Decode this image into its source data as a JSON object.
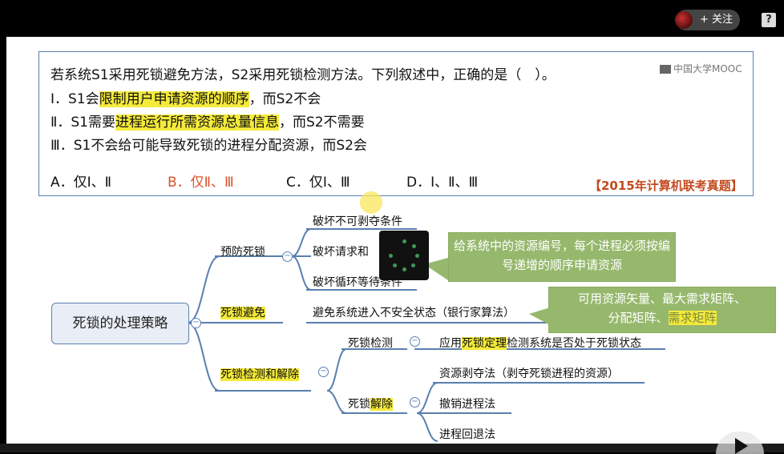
{
  "topbar": {
    "follow_label": "+ 关注",
    "help": "?"
  },
  "question": {
    "stem": "若系统S1采用死锁避免方法，S2采用死锁检测方法。下列叙述中，正确的是（　）。",
    "line1_pre": "Ⅰ．S1会",
    "line1_hl": "限制用户申请资源的顺序",
    "line1_post": "，而S2不会",
    "line2_pre": "Ⅱ．S1需要",
    "line2_hl": "进程运行所需资源总量信息",
    "line2_post": "，而S2不需要",
    "line3": "Ⅲ．S1不会给可能导致死锁的进程分配资源，而S2会",
    "opt_a": "A．仅Ⅰ、Ⅱ",
    "opt_b": "B．仅Ⅱ、Ⅲ",
    "opt_c": "C．仅Ⅰ、Ⅲ",
    "opt_d": "D．Ⅰ、Ⅱ、Ⅲ",
    "source": "【2015年计算机联考真题】",
    "logo": "中国大学MOOC",
    "colors": {
      "highlight": "#f4ea3a",
      "answer": "#d9532b",
      "source": "#c34a1e"
    }
  },
  "mindmap": {
    "root": "死锁的处理策略",
    "prevent": "预防死锁",
    "prevent_1": "破坏不可剥夺条件",
    "prevent_2": "破坏请求和",
    "prevent_3": "破坏循环等待条件",
    "avoid": "死锁避免",
    "avoid_1": "避免系统进入不安全状态（银行家算法）",
    "detect_resolve": "死锁检测和解除",
    "detect": "死锁检测",
    "detect_1_pre": "应用",
    "detect_1_hl": "死锁定理",
    "detect_1_post": "检测系统是否处于死锁状态",
    "resolve_pre": "死锁",
    "resolve_hl": "解除",
    "resolve_1": "资源剥夺法（剥夺死锁进程的资源）",
    "resolve_2": "撤销进程法",
    "resolve_3": "进程回退法",
    "note1": "给系统中的资源编号，每个进程必须按编号递增的顺序申请资源",
    "note2_a": "可用资源矢量、最大需求矩阵、",
    "note2_b": "分配矩阵、",
    "note2_hl": "需求矩阵",
    "colors": {
      "line": "#5a7fb0",
      "note": "#96b86c"
    }
  }
}
